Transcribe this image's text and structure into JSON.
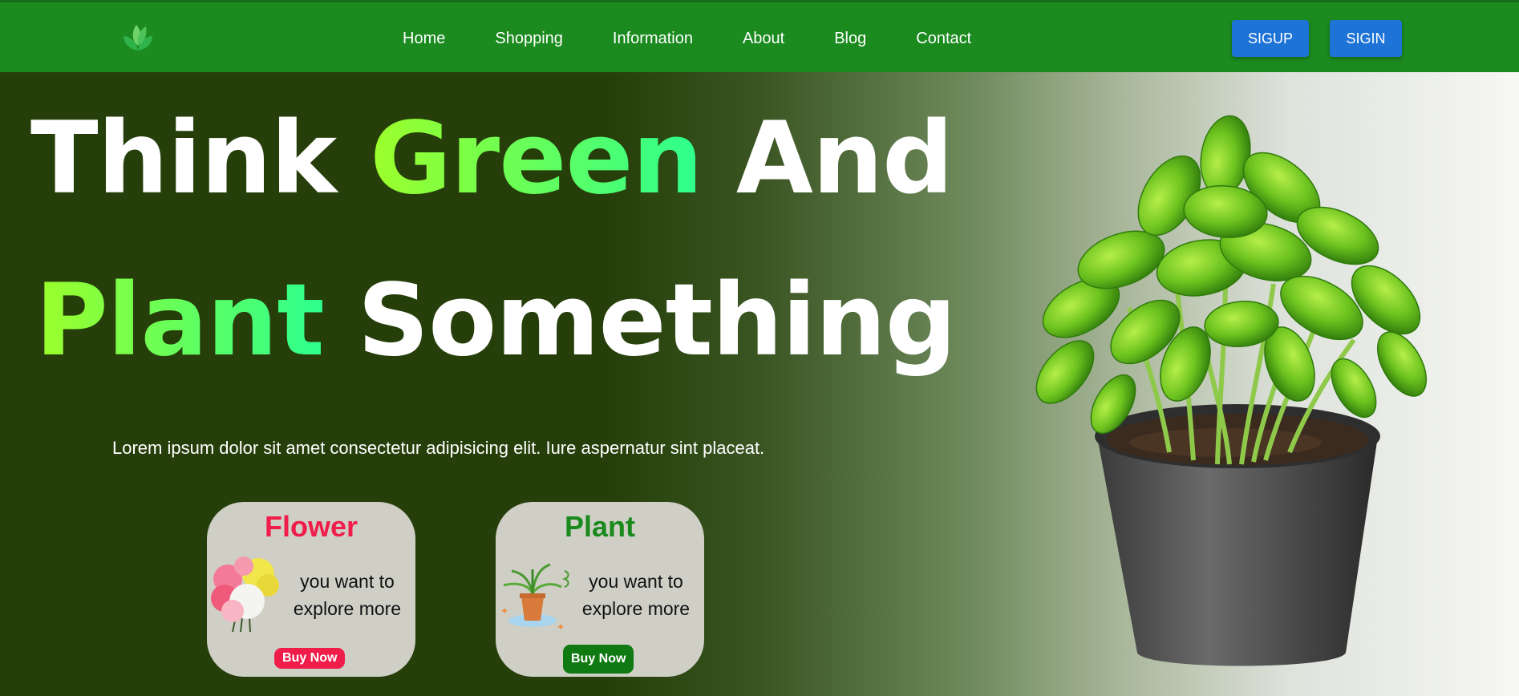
{
  "nav": {
    "logo_icon": "leaf-logo-icon",
    "links": [
      "Home",
      "Shopping",
      "Information",
      "About",
      "Blog",
      "Contact"
    ],
    "signup_label": "SIGUP",
    "signin_label": "SIGIN"
  },
  "hero": {
    "line1_word1": "Think",
    "line1_word2": "Green",
    "line1_word3": "And",
    "line2_word1": "Plant",
    "line2_word2": "Something",
    "subtitle": "Lorem ipsum dolor sit amet consectetur adipisicing elit. Iure aspernatur sint placeat."
  },
  "cards": [
    {
      "title": "Flower",
      "desc_line1": "you want to",
      "desc_line2": "explore more",
      "button": "Buy Now",
      "image": "flower-bouquet-image"
    },
    {
      "title": "Plant",
      "desc_line1": "you want to",
      "desc_line2": "explore more",
      "button": "Buy Now",
      "image": "potted-plant-image"
    }
  ],
  "hero_image": "basil-pot-image",
  "colors": {
    "nav_bg": "#1b8a1f",
    "auth_button": "#1e74d6",
    "flower_accent": "#f01d4a",
    "plant_accent": "#1a8a1c",
    "hero_dark": "#263f0a"
  }
}
